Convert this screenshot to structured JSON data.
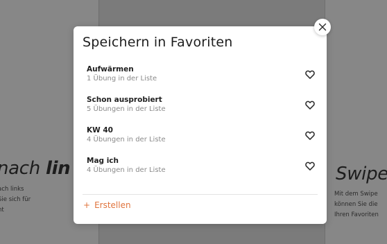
{
  "background": {
    "left_heading_light": "nach ",
    "left_heading_bold": "lin",
    "left_text": "ach links\nSie sich für\nnt",
    "right_heading": "Swipe",
    "right_text": "Mit dem Swipe\nkönnen Sie die\nIhren Favoriten"
  },
  "modal": {
    "title": "Speichern in Favoriten",
    "close_icon": "close-icon",
    "favorite_icon": "heart-outline-icon",
    "items": [
      {
        "name": "Aufwärmen",
        "count": "1 Übung in der Liste"
      },
      {
        "name": "Schon ausprobiert",
        "count": "5 Übungen in der Liste"
      },
      {
        "name": "KW 40",
        "count": "4 Übungen in der Liste"
      },
      {
        "name": "Mag ich",
        "count": "4 Übungen in der Liste"
      }
    ],
    "create": {
      "plus": "+",
      "label": "Erstellen"
    }
  },
  "colors": {
    "accent": "#e0743d",
    "overlay": "#7b7b7b",
    "modal_bg": "#ffffff"
  }
}
